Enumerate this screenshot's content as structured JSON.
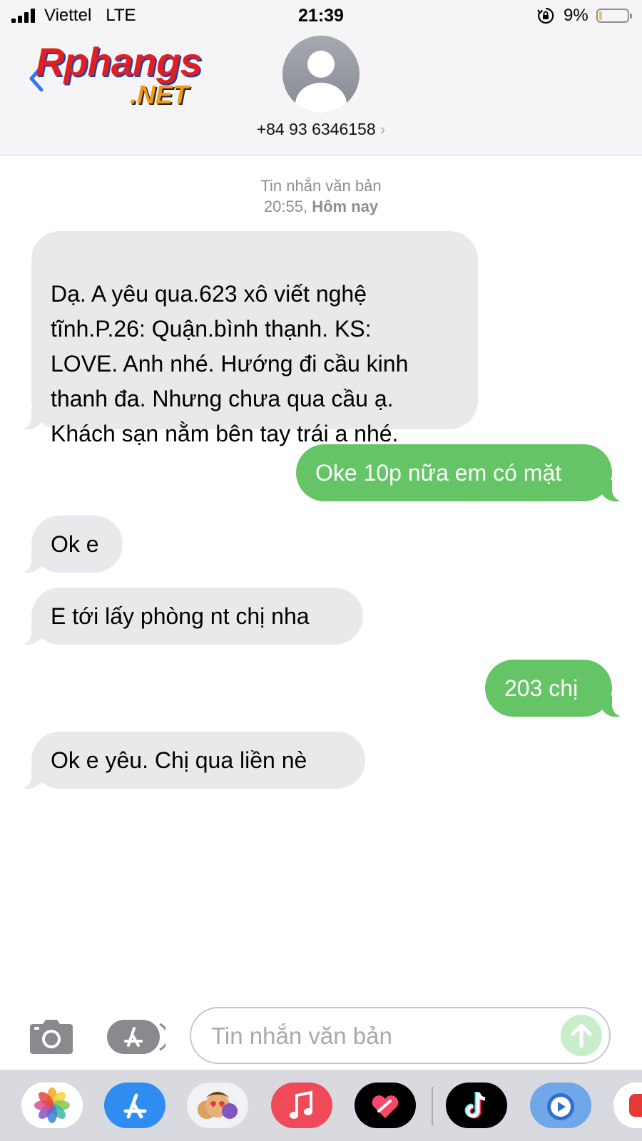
{
  "status_bar": {
    "carrier": "Viettel",
    "network": "LTE",
    "time": "21:39",
    "battery_percent": "9%",
    "battery_level": 0.09,
    "signal_bars": 4
  },
  "header": {
    "back_icon": "chevron-left-icon",
    "logo_text": "Rphangs",
    "logo_subtext": ".NET",
    "contact_number": "+84 93 6346158",
    "contact_chevron": "›"
  },
  "conversation": {
    "type_label": "Tin nhắn văn bản",
    "time_value": "20:55,",
    "day_label": "Hôm nay",
    "messages": [
      {
        "direction": "incoming",
        "text": "Dạ. A yêu qua.623 xô viết nghệ\ntĩnh.P.26: Quận.bình thạnh. KS:\nLOVE. Anh nhé. Hướng đi cầu kinh\nthanh đa. Nhưng chưa qua cầu ạ.\nKhách sạn nằm bên tay trái a nhé."
      },
      {
        "direction": "outgoing",
        "text": "Oke 10p nữa em có mặt"
      },
      {
        "direction": "incoming",
        "text": "Ok e"
      },
      {
        "direction": "incoming",
        "text": "E tới lấy phòng nt chị nha"
      },
      {
        "direction": "outgoing",
        "text": "203 chị"
      },
      {
        "direction": "incoming",
        "text": "Ok e yêu.  Chị qua liền nè"
      }
    ]
  },
  "composer": {
    "placeholder": "Tin nhắn văn bản",
    "value": "",
    "camera_icon": "camera-icon",
    "apps_icon": "app-store-icon",
    "send_icon": "arrow-up-icon"
  },
  "app_drawer": {
    "apps": [
      "photos-icon",
      "app-store-icon",
      "memoji-icon",
      "music-icon",
      "digital-touch-icon",
      "tiktok-icon",
      "music-app-icon",
      "partial-app-icon"
    ]
  },
  "colors": {
    "outgoing_bubble": "#65c466",
    "incoming_bubble": "#e9e9eb",
    "header_bg": "#f5f5f7",
    "dock_bg": "#d9dadf"
  }
}
